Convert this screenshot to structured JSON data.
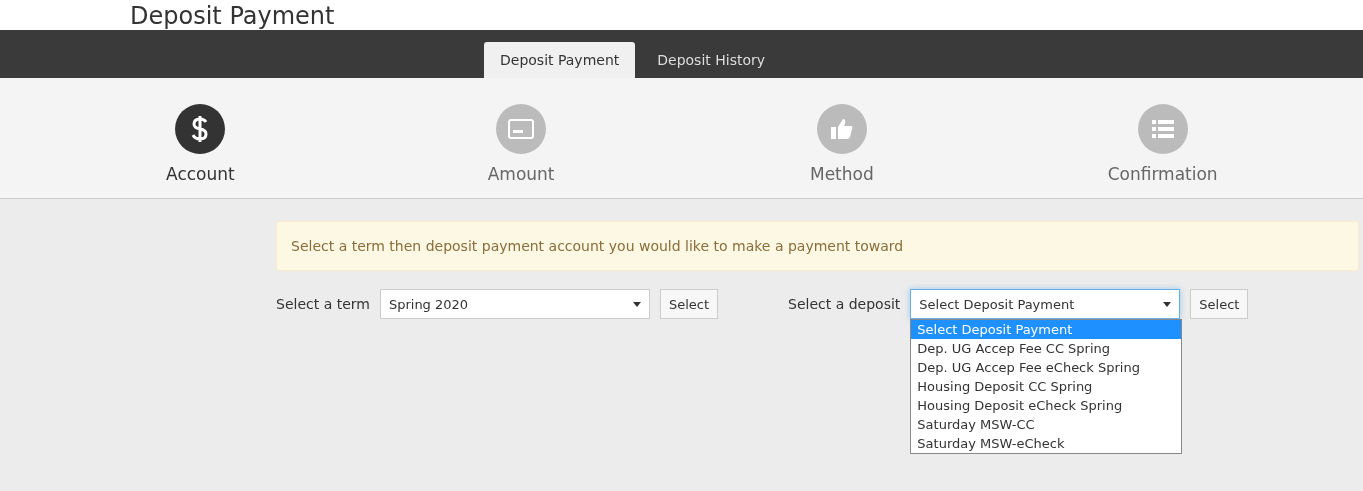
{
  "page_title": "Deposit Payment",
  "tabs": [
    {
      "label": "Deposit Payment",
      "selected": true
    },
    {
      "label": "Deposit History",
      "selected": false
    }
  ],
  "steps": [
    {
      "label": "Account",
      "kind": "dollar",
      "selected": true
    },
    {
      "label": "Amount",
      "kind": "card",
      "selected": false
    },
    {
      "label": "Method",
      "kind": "thumb",
      "selected": false
    },
    {
      "label": "Confirmation",
      "kind": "list",
      "selected": false
    }
  ],
  "alert": "Select a term then deposit payment account you would like to make a payment toward",
  "term": {
    "label": "Select a term",
    "value": "Spring 2020",
    "button": "Select"
  },
  "deposit": {
    "label": "Select a deposit",
    "value": "Select Deposit Payment",
    "button": "Select",
    "expanded": true,
    "options": [
      {
        "label": "Select Deposit Payment",
        "selected": true
      },
      {
        "label": "Dep. UG Accep Fee CC Spring",
        "selected": false
      },
      {
        "label": "Dep. UG Accep Fee eCheck Spring",
        "selected": false
      },
      {
        "label": "Housing Deposit CC Spring",
        "selected": false
      },
      {
        "label": "Housing Deposit eCheck Spring",
        "selected": false
      },
      {
        "label": "Saturday MSW-CC",
        "selected": false
      },
      {
        "label": "Saturday MSW-eCheck",
        "selected": false
      }
    ]
  }
}
